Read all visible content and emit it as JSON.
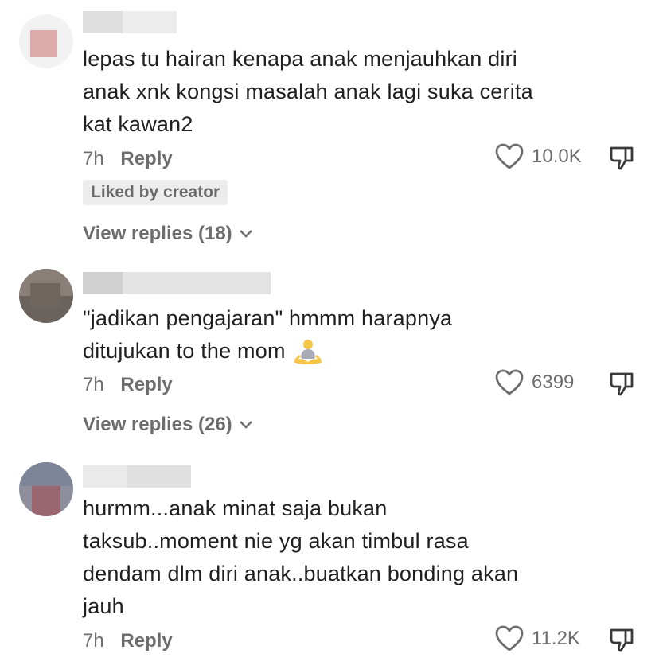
{
  "comments": [
    {
      "text": "lepas tu hairan kenapa anak menjauhkan diri anak xnk kongsi masalah anak lagi suka cerita kat kawan2",
      "lines": [
        "lepas tu hairan kenapa anak menjauhkan diri",
        "anak xnk kongsi masalah anak lagi suka cerita",
        "kat kawan2"
      ],
      "time": "7h",
      "reply_label": "Reply",
      "likes": "10.0K",
      "badge": "Liked by creator",
      "view_replies": "View replies (18)"
    },
    {
      "lines": [
        "\"jadikan pengajaran\" hmmm harapnya",
        "ditujukan to the mom"
      ],
      "emoji": "person-in-lotus-position-emoji",
      "time": "7h",
      "reply_label": "Reply",
      "likes": "6399",
      "view_replies": "View replies (26)"
    },
    {
      "lines": [
        "hurmm...anak minat saja bukan",
        "taksub..moment nie yg akan timbul rasa",
        "dendam dlm diri anak..buatkan bonding akan",
        "jauh"
      ],
      "time": "7h",
      "reply_label": "Reply",
      "likes": "11.2K"
    }
  ],
  "icons": {
    "like": "heart-icon",
    "dislike": "thumbs-down-icon",
    "chevron": "chevron-down-icon"
  },
  "colors": {
    "text": "#1f1f1f",
    "muted": "#6d6d6d",
    "badge_bg": "#ececec",
    "background": "#ffffff"
  }
}
